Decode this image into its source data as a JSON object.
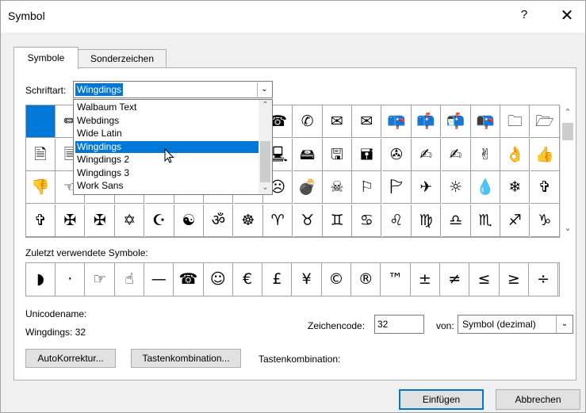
{
  "window": {
    "title": "Symbol",
    "help": "?",
    "close": "✕"
  },
  "tabs": [
    {
      "label": "Symbole",
      "active": true
    },
    {
      "label": "Sonderzeichen",
      "active": false
    }
  ],
  "font": {
    "label": "Schriftart:",
    "value": "Wingdings",
    "options": [
      "Walbaum Text",
      "Webdings",
      "Wide Latin",
      "Wingdings",
      "Wingdings 2",
      "Wingdings 3",
      "Work Sans"
    ],
    "selected_index": 3
  },
  "grid": {
    "rows": [
      [
        "",
        "✏",
        "✂",
        "✁",
        "👓",
        "🔔",
        "📖",
        "🕯",
        "☎",
        "✆",
        "✉",
        "✉",
        "📪",
        "📫",
        "📬",
        "📭",
        "🗀",
        "🗁"
      ],
      [
        "🗎",
        "🗏",
        "🗐",
        "🗄",
        "⌛",
        "🖮",
        "🖰",
        "🖲",
        "🖳",
        "🖴",
        "🖫",
        "🖬",
        "✇",
        "✍",
        "✍",
        "✌",
        "👌",
        "👍"
      ],
      [
        "👎",
        "☜",
        "☞",
        "☝",
        "☟",
        "✋",
        "☺",
        "😐",
        "☹",
        "💣",
        "☠",
        "⚐",
        "🏱",
        "✈",
        "☼",
        "💧",
        "❄",
        "✞"
      ],
      [
        "✞",
        "✠",
        "✠",
        "✡",
        "☪",
        "☯",
        "ॐ",
        "☸",
        "♈",
        "♉",
        "♊",
        "♋",
        "♌",
        "♍",
        "♎",
        "♏",
        "♐",
        "♑"
      ]
    ],
    "selected": [
      0,
      0
    ]
  },
  "recent": {
    "label": "Zuletzt verwendete Symbole:",
    "symbols": [
      "◗",
      "·",
      "☞",
      "☝",
      "—",
      "☎",
      "☺",
      "€",
      "£",
      "¥",
      "©",
      "®",
      "™",
      "±",
      "≠",
      "≤",
      "≥",
      "÷"
    ]
  },
  "unicode": {
    "label": "Unicodename:",
    "value": "Wingdings: 32"
  },
  "code": {
    "label": "Zeichencode:",
    "value": "32",
    "from_label": "von:",
    "from_value": "Symbol (dezimal)"
  },
  "buttons": {
    "autocorrect": "AutoKorrektur...",
    "shortcut_key": "Tastenkombination...",
    "shortcut_label": "Tastenkombination:",
    "insert": "Einfügen",
    "cancel": "Abbrechen"
  },
  "colors": {
    "accent": "#0078d7",
    "background": "#f0f0f0",
    "border": "#a0a0a0"
  }
}
